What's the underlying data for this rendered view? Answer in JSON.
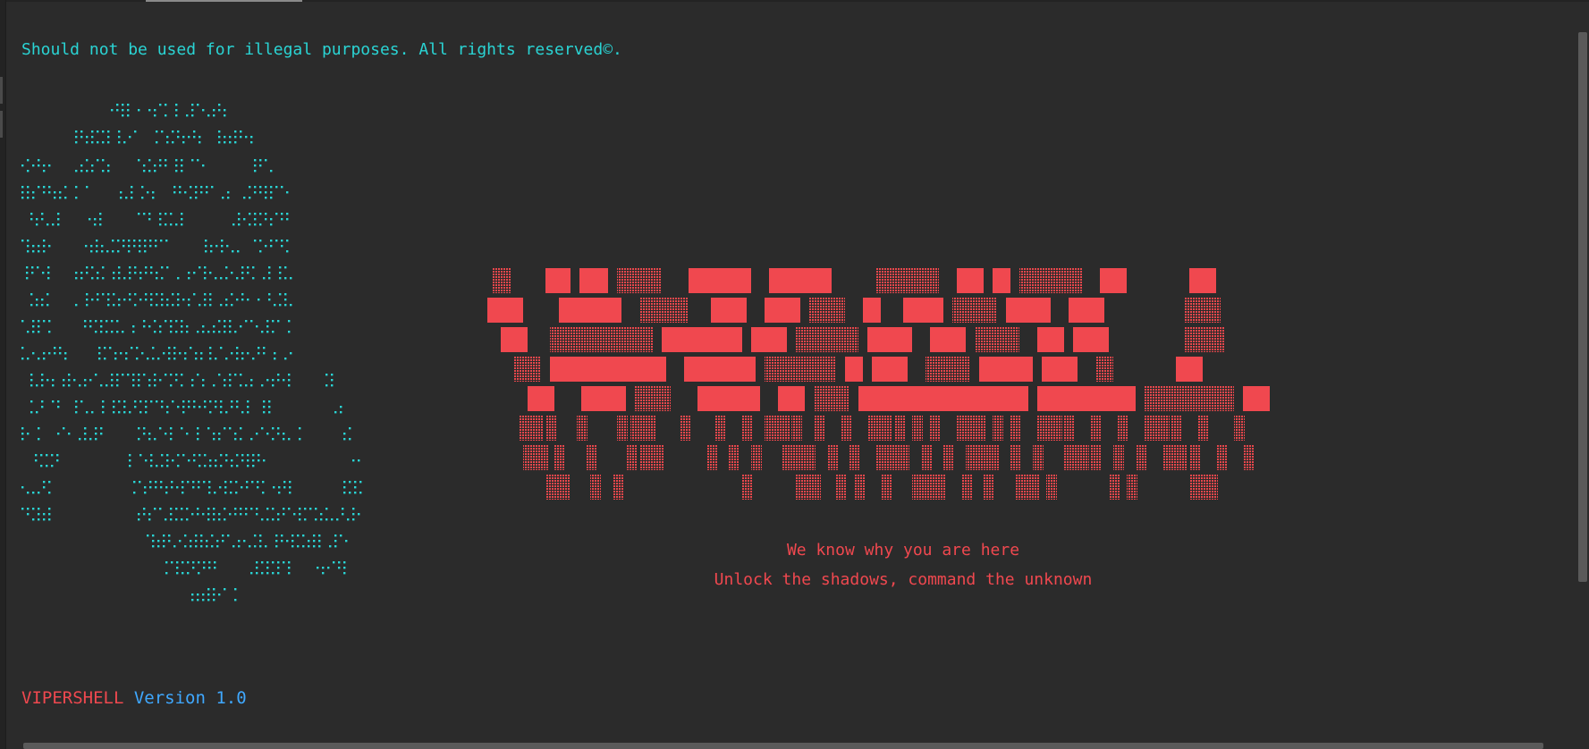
{
  "terminal": {
    "notice": "Should not be used for illegal purposes. All rights reserved©.",
    "art": {
      "skull_icon": "skull-ascii-art",
      "banner_icon": "vipershell-block-banner"
    },
    "tagline_1": "We know why you are here",
    "tagline_2": "Unlock the shadows, command the unknown",
    "brand_name": "VIPERSHELL",
    "version_label": "Version 1.0"
  },
  "colors": {
    "background": "#2b2b2b",
    "cyan_text": "#2ad4d4",
    "red_text": "#f0484f",
    "blue_text": "#3fa8ff"
  }
}
